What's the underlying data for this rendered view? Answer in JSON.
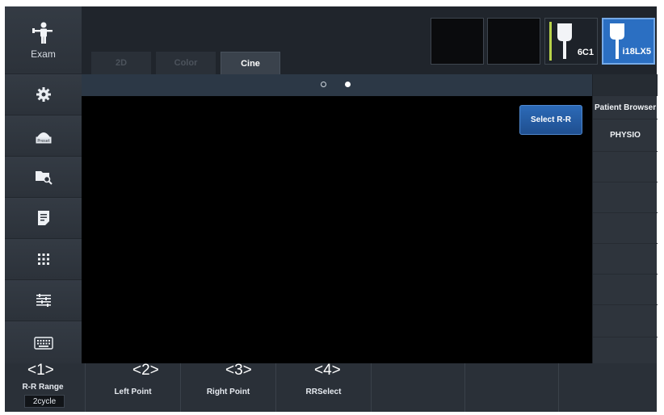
{
  "sidebar": {
    "exam_label": "Exam",
    "buttons": [
      "gear-icon",
      "preset-icon",
      "folder-search-icon",
      "report-icon",
      "grid-icon",
      "list-icon",
      "keyboard-icon"
    ]
  },
  "tabs": [
    {
      "label": "2D",
      "state": "dimmed"
    },
    {
      "label": "Color",
      "state": "dimmed"
    },
    {
      "label": "Cine",
      "state": "active"
    }
  ],
  "probes": [
    {
      "label": "",
      "state": "empty"
    },
    {
      "label": "",
      "state": "empty"
    },
    {
      "label": "6C1",
      "state": "idle",
      "accent": "#b8d24a"
    },
    {
      "label": "i18LX5",
      "state": "selected"
    }
  ],
  "pager": {
    "pages": 2,
    "current": 2
  },
  "main": {
    "select_rr_label": "Select R-R"
  },
  "right_panel": {
    "items": [
      "Patient Browser",
      "PHYSIO",
      "",
      "",
      "",
      "",
      "",
      ""
    ]
  },
  "bottom": {
    "controls": [
      {
        "number": "<1>",
        "title": "R-R Range",
        "value": "2cycle"
      },
      {
        "number": "<2>",
        "label": "Left Point"
      },
      {
        "number": "<3>",
        "label": "Right Point"
      },
      {
        "number": "<4>",
        "label": "RRSelect"
      }
    ]
  },
  "colors": {
    "accent_blue": "#2b6fc2",
    "panel": "#2a3038",
    "image_area": "#000000"
  }
}
